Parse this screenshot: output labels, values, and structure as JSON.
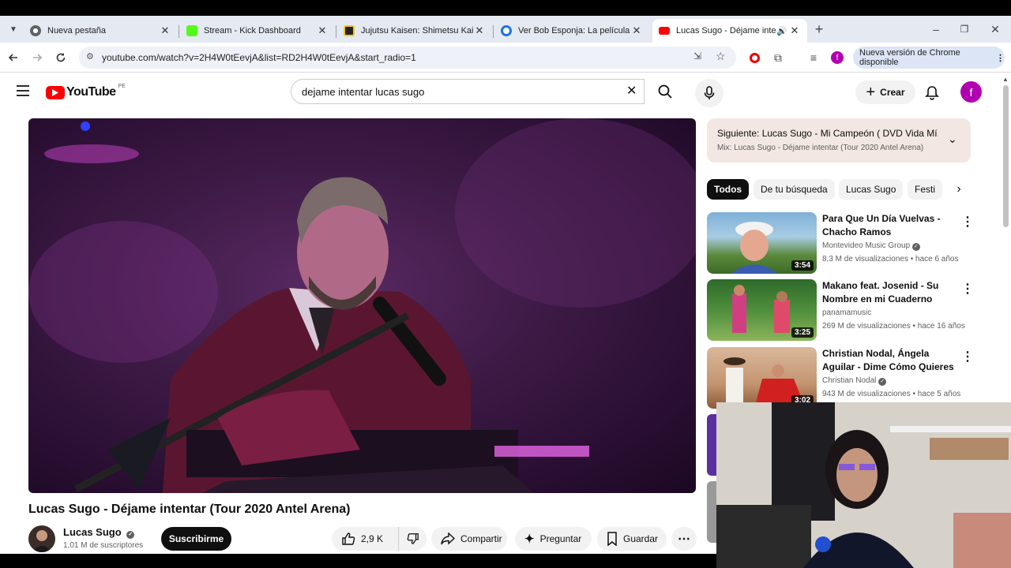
{
  "browser": {
    "tabs": [
      {
        "title": "Nueva pestaña"
      },
      {
        "title": "Stream - Kick Dashboard"
      },
      {
        "title": "Jujutsu Kaisen: Shimetsu Kaiyu"
      },
      {
        "title": "Ver Bob Esponja: La película On"
      },
      {
        "title": "Lucas Sugo - Déjame intent"
      }
    ],
    "url": "youtube.com/watch?v=2H4W0tEevjA&list=RD2H4W0tEevjA&start_radio=1",
    "update_label": "Nueva versión de Chrome disponible",
    "profile_initial": "f"
  },
  "youtube": {
    "logo_text": "YouTube",
    "country": "PE",
    "search_query": "dejame intentar lucas sugo",
    "create_label": "Crear",
    "avatar_initial": "f"
  },
  "video": {
    "title": "Lucas Sugo - Déjame intentar (Tour 2020 Antel Arena)",
    "channel": "Lucas Sugo",
    "subscribers": "1,01 M de suscriptores",
    "subscribe_label": "Suscribirme",
    "likes": "2,9 K",
    "share_label": "Compartir",
    "ask_label": "Preguntar",
    "save_label": "Guardar"
  },
  "up_next": {
    "line1": "Siguiente: Lucas Sugo - Mi Campeón ( DVD Vida Mí...",
    "line2": "Mix: Lucas Sugo - Déjame intentar (Tour 2020 Antel Arena)"
  },
  "chips": [
    "Todos",
    "De tu búsqueda",
    "Lucas Sugo",
    "Festi"
  ],
  "recommendations": [
    {
      "title": "Para Que Un Día Vuelvas - Chacho Ramos",
      "channel": "Montevideo Music Group",
      "meta": "8,3 M de visualizaciones • hace 6 años",
      "duration": "3:54"
    },
    {
      "title": "Makano feat. Josenid - Su Nombre en mi Cuaderno [Vide...",
      "channel": "panamamusic",
      "meta": "269 M de visualizaciones • hace 16 años",
      "duration": "3:25"
    },
    {
      "title": "Christian Nodal, Ángela Aguilar - Dime Cómo Quieres (Video ...",
      "channel": "Christian Nodal",
      "meta": "943 M de visualizaciones • hace 5 años",
      "duration": "3:02"
    }
  ],
  "colors": {
    "brand_red": "#ff0000",
    "avatar": "#b000b0",
    "up_next_bg": "#f2e7e2"
  }
}
